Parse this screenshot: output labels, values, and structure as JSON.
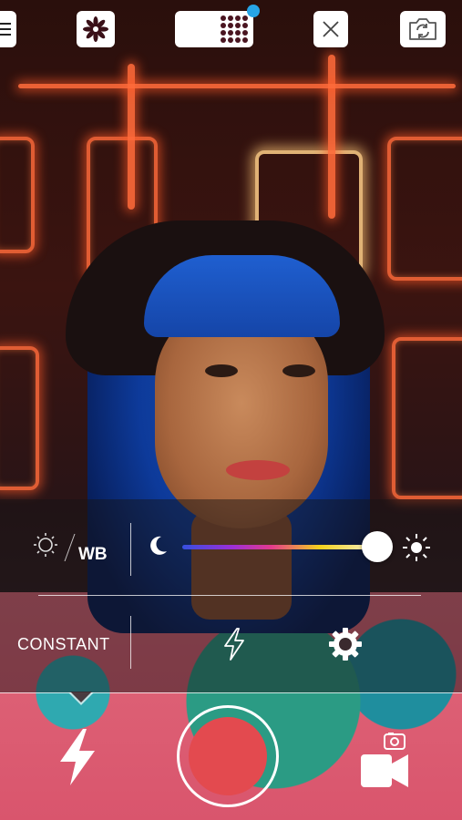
{
  "toolbar": {
    "menu": "menu-icon",
    "filter": "flower-filter-icon",
    "grid": "dot-grid-icon",
    "grid_badge": "notification-dot",
    "close": "close-icon",
    "flip": "flip-camera-icon"
  },
  "settings": {
    "wb_label": "WB",
    "auto_wb_icon": "auto-brightness-icon",
    "cool_icon": "moon-icon",
    "warm_icon": "sun-icon",
    "wb_slider_value": 0.98,
    "mode_label": "CONSTANT",
    "flash_outline_icon": "flash-outline-icon",
    "settings_icon": "gear-icon"
  },
  "bottom": {
    "flash": "flash-icon",
    "shutter": "record-button",
    "video": "video-camera-icon"
  },
  "colors": {
    "shutter_red": "#e34a4f",
    "badge_blue": "#27a4e6",
    "grid_dots": "#4a1520"
  }
}
